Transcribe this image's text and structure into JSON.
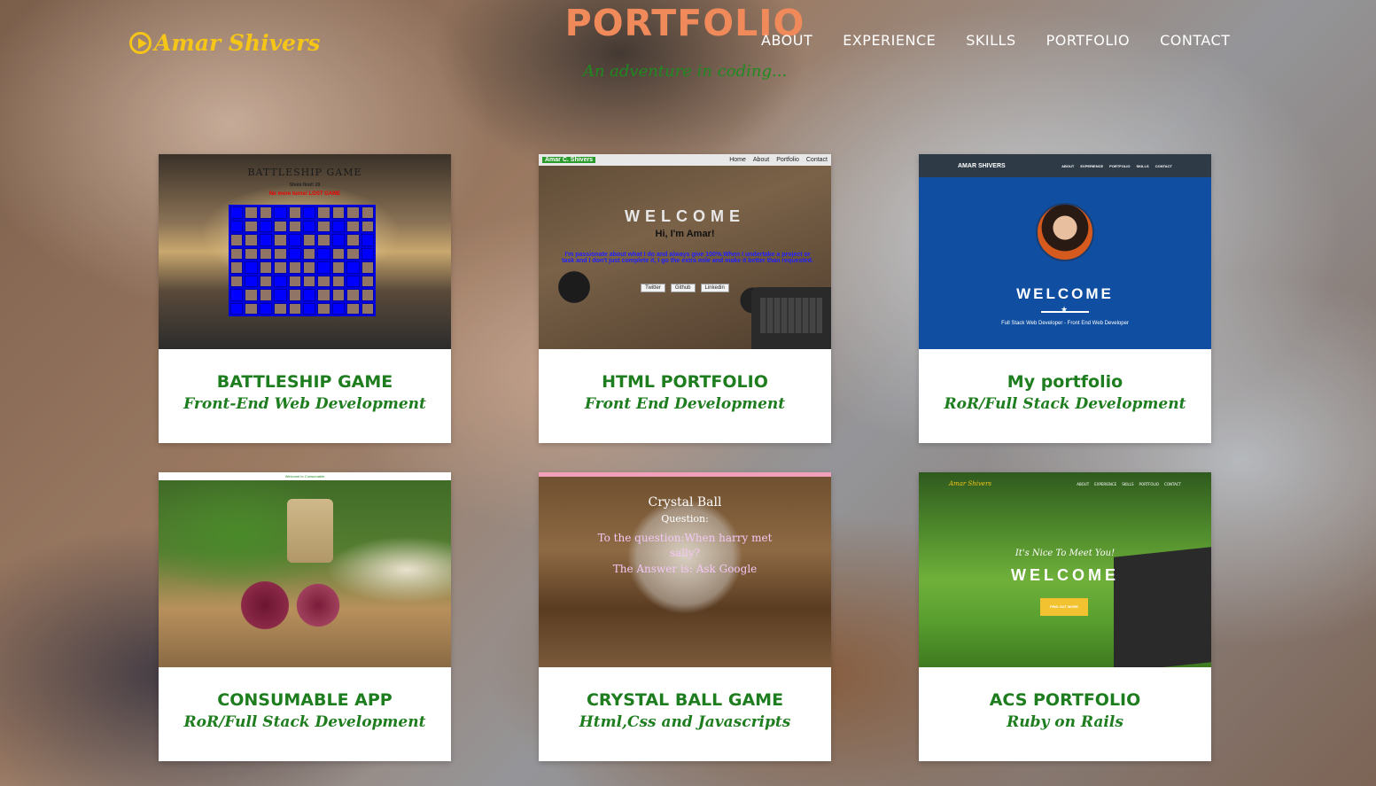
{
  "header": {
    "logo_text": "Amar Shivers",
    "page_title": "PORTFOLIO",
    "subtitle": "An adventure in coding...",
    "nav": [
      "ABOUT",
      "EXPERIENCE",
      "SKILLS",
      "PORTFOLIO",
      "CONTACT"
    ]
  },
  "colors": {
    "title": "#f08a5a",
    "green_text": "#1e7d1e",
    "logo": "#f5c518"
  },
  "cards": [
    {
      "title": "BATTLESHIP GAME",
      "subtitle": "Front-End Web Development",
      "thumb": {
        "heading": "BATTLESHIP GAME",
        "shots_fired": "Shots fired: 29",
        "status": "No more turns! LOST GAME"
      }
    },
    {
      "title": "HTML PORTFOLIO",
      "subtitle": "Front End Development",
      "thumb": {
        "brand": "Amar C. Shivers",
        "nav": [
          "Home",
          "About",
          "Portfolio",
          "Contact"
        ],
        "welcome": "WELCOME",
        "greeting": "Hi, I'm Amar!",
        "text": "I'm passionate about what I do and always give 100%.When I undertake a project or task and I don't just complete it, I go the extra mile and make it better than requested.",
        "buttons": [
          "Twitter",
          "Github",
          "Linkedin"
        ]
      }
    },
    {
      "title": "My portfolio",
      "subtitle": "RoR/Full Stack Development",
      "thumb": {
        "brand": "AMAR SHIVERS",
        "nav": [
          "ABOUT",
          "EXPERIENCE",
          "PORTFOLIO",
          "SKILLS",
          "CONTACT"
        ],
        "welcome": "WELCOME",
        "tagline": "Full Stack Web Developer - Front End Web Developer"
      }
    },
    {
      "title": "CONSUMABLE APP",
      "subtitle": "RoR/Full Stack Development",
      "thumb": {
        "header": "Welcome to Consumable"
      }
    },
    {
      "title": "CRYSTAL BALL GAME",
      "subtitle": "Html,Css and Javascripts",
      "thumb": {
        "heading": "Crystal Ball",
        "question_label": "Question:",
        "question": "To the question:When harry met sally?",
        "answer": "The Answer is: Ask Google"
      }
    },
    {
      "title": "ACS PORTFOLIO",
      "subtitle": "Ruby on Rails",
      "thumb": {
        "brand": "Amar Shivers",
        "nav": [
          "ABOUT",
          "EXPERIENCE",
          "SKILLS",
          "PORTFOLIO",
          "CONTACT"
        ],
        "nice": "It's Nice To Meet You!",
        "welcome": "WELCOME",
        "button": "FIND OUT MORE"
      }
    }
  ]
}
